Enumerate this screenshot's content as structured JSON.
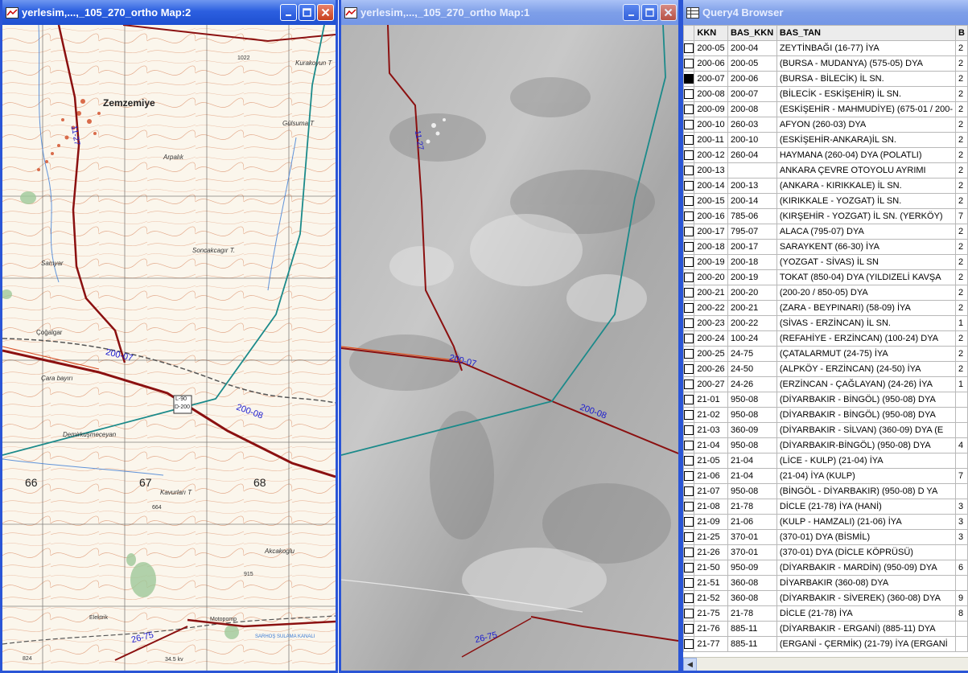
{
  "windows": {
    "map2": {
      "title": "yerlesim,...,_105_270_ortho Map:2"
    },
    "map1": {
      "title": "yerlesim,...,_105_270_ortho Map:1"
    },
    "browser": {
      "title": "Query4 Browser"
    }
  },
  "map2_labels": {
    "town": "Zemzemiye",
    "grid_66": "66",
    "grid_67": "67",
    "grid_68": "68",
    "road_200_07": "200-07",
    "road_200_08": "200-08",
    "road_11_27": "11-27",
    "road_26_75": "26-75",
    "place_kurakoyun": "Kurakoyun T",
    "place_gulsuma": "Gülsuma T",
    "place_arpalik": "Arpalık",
    "place_sancakcagir": "Soncakcagır T.",
    "place_samyar": "Samyar",
    "place_cara": "Çara bayırı",
    "place_demirkan": "Demirkuşmeceyan",
    "place_kavurlari": "Kavurları T",
    "place_akcakogu": "Akcakoglu",
    "place_cogalgar": "Çoğalgar",
    "place_elektrik": "Elektrik",
    "place_motopomp": "Motopomp",
    "place_sarhog": "SARHOŞ SULAMA KANALI",
    "marker_top": "L-90",
    "marker_bottom": "D-200",
    "elev_1022": "1022",
    "elev_664": "664",
    "elev_915": "915",
    "elev_824": "824",
    "kv": "34.5 kv"
  },
  "map1_labels": {
    "road_11_27": "11-27",
    "road_200_07": "200-07",
    "road_200_08": "200-08",
    "road_26_75": "26-75"
  },
  "browser": {
    "columns": [
      "KKN",
      "BAS_KKN",
      "BAS_TAN",
      "B"
    ],
    "rows": [
      {
        "kkn": "200-05",
        "bas": "200-04",
        "tan": "ZEYTİNBAĞI (16-77) İYA",
        "b": "2",
        "checked": false
      },
      {
        "kkn": "200-06",
        "bas": "200-05",
        "tan": "(BURSA - MUDANYA) (575-05) DYA",
        "b": "2",
        "checked": false
      },
      {
        "kkn": "200-07",
        "bas": "200-06",
        "tan": "(BURSA - BİLECİK) İL SN.",
        "b": "2",
        "checked": true
      },
      {
        "kkn": "200-08",
        "bas": "200-07",
        "tan": "(BİLECİK - ESKİŞEHİR) İL SN.",
        "b": "2",
        "checked": false
      },
      {
        "kkn": "200-09",
        "bas": "200-08",
        "tan": "(ESKİŞEHİR - MAHMUDİYE) (675-01 / 200-",
        "b": "2",
        "checked": false
      },
      {
        "kkn": "200-10",
        "bas": "260-03",
        "tan": "AFYON (260-03) DYA",
        "b": "2",
        "checked": false
      },
      {
        "kkn": "200-11",
        "bas": "200-10",
        "tan": "(ESKİŞEHİR-ANKARA)İL SN.",
        "b": "2",
        "checked": false
      },
      {
        "kkn": "200-12",
        "bas": "260-04",
        "tan": "HAYMANA (260-04) DYA (POLATLI)",
        "b": "2",
        "checked": false
      },
      {
        "kkn": "200-13",
        "bas": "",
        "tan": "ANKARA ÇEVRE OTOYOLU AYRIMI",
        "b": "2",
        "checked": false
      },
      {
        "kkn": "200-14",
        "bas": "200-13",
        "tan": "(ANKARA - KIRIKKALE) İL SN.",
        "b": "2",
        "checked": false
      },
      {
        "kkn": "200-15",
        "bas": "200-14",
        "tan": "(KIRIKKALE - YOZGAT) İL SN.",
        "b": "2",
        "checked": false
      },
      {
        "kkn": "200-16",
        "bas": "785-06",
        "tan": "(KIRŞEHİR - YOZGAT) İL SN. (YERKÖY)",
        "b": "7",
        "checked": false
      },
      {
        "kkn": "200-17",
        "bas": "795-07",
        "tan": "ALACA (795-07) DYA",
        "b": "2",
        "checked": false
      },
      {
        "kkn": "200-18",
        "bas": "200-17",
        "tan": "SARAYKENT (66-30) İYA",
        "b": "2",
        "checked": false
      },
      {
        "kkn": "200-19",
        "bas": "200-18",
        "tan": "(YOZGAT - SİVAS) İL SN",
        "b": "2",
        "checked": false
      },
      {
        "kkn": "200-20",
        "bas": "200-19",
        "tan": "TOKAT (850-04) DYA (YILDIZELİ KAVŞA",
        "b": "2",
        "checked": false
      },
      {
        "kkn": "200-21",
        "bas": "200-20",
        "tan": "(200-20 / 850-05) DYA",
        "b": "2",
        "checked": false
      },
      {
        "kkn": "200-22",
        "bas": "200-21",
        "tan": "(ZARA - BEYPINARI) (58-09) İYA",
        "b": "2",
        "checked": false
      },
      {
        "kkn": "200-23",
        "bas": "200-22",
        "tan": "(SİVAS - ERZİNCAN) İL SN.",
        "b": "1",
        "checked": false
      },
      {
        "kkn": "200-24",
        "bas": "100-24",
        "tan": "(REFAHİYE - ERZİNCAN) (100-24) DYA",
        "b": "2",
        "checked": false
      },
      {
        "kkn": "200-25",
        "bas": "24-75",
        "tan": "(ÇATALARMUT (24-75) İYA",
        "b": "2",
        "checked": false
      },
      {
        "kkn": "200-26",
        "bas": "24-50",
        "tan": "(ALPKÖY - ERZİNCAN) (24-50) İYA",
        "b": "2",
        "checked": false
      },
      {
        "kkn": "200-27",
        "bas": "24-26",
        "tan": "(ERZİNCAN - ÇAĞLAYAN) (24-26) İYA",
        "b": "1",
        "checked": false
      },
      {
        "kkn": "21-01",
        "bas": "950-08",
        "tan": "(DİYARBAKIR - BİNGÖL) (950-08) DYA",
        "b": "",
        "checked": false
      },
      {
        "kkn": "21-02",
        "bas": "950-08",
        "tan": "(DİYARBAKIR - BİNGÖL) (950-08) DYA",
        "b": "",
        "checked": false
      },
      {
        "kkn": "21-03",
        "bas": "360-09",
        "tan": "(DİYARBAKIR - SİLVAN) (360-09) DYA (E",
        "b": "",
        "checked": false
      },
      {
        "kkn": "21-04",
        "bas": "950-08",
        "tan": "(DİYARBAKIR-BİNGÖL) (950-08) DYA",
        "b": "4",
        "checked": false
      },
      {
        "kkn": "21-05",
        "bas": "21-04",
        "tan": "(LİCE - KULP) (21-04) İYA",
        "b": "",
        "checked": false
      },
      {
        "kkn": "21-06",
        "bas": "21-04",
        "tan": "(21-04) İYA (KULP)",
        "b": "7",
        "checked": false
      },
      {
        "kkn": "21-07",
        "bas": "950-08",
        "tan": "(BİNGÖL - DİYARBAKIR) (950-08) D YA",
        "b": "",
        "checked": false
      },
      {
        "kkn": "21-08",
        "bas": "21-78",
        "tan": "DİCLE (21-78) İYA (HANİ)",
        "b": "3",
        "checked": false
      },
      {
        "kkn": "21-09",
        "bas": "21-06",
        "tan": "(KULP - HAMZALI) (21-06) İYA",
        "b": "3",
        "checked": false
      },
      {
        "kkn": "21-25",
        "bas": "370-01",
        "tan": "(370-01) DYA (BİSMİL)",
        "b": "3",
        "checked": false
      },
      {
        "kkn": "21-26",
        "bas": "370-01",
        "tan": "(370-01) DYA (DİCLE KÖPRÜSÜ)",
        "b": "",
        "checked": false
      },
      {
        "kkn": "21-50",
        "bas": "950-09",
        "tan": "(DİYARBAKIR - MARDİN) (950-09) DYA",
        "b": "6",
        "checked": false
      },
      {
        "kkn": "21-51",
        "bas": "360-08",
        "tan": "DİYARBAKIR (360-08) DYA",
        "b": "",
        "checked": false
      },
      {
        "kkn": "21-52",
        "bas": "360-08",
        "tan": "(DİYARBAKIR - SİVEREK) (360-08) DYA",
        "b": "9",
        "checked": false
      },
      {
        "kkn": "21-75",
        "bas": "21-78",
        "tan": "DİCLE (21-78) İYA",
        "b": "8",
        "checked": false
      },
      {
        "kkn": "21-76",
        "bas": "885-11",
        "tan": "(DİYARBAKIR - ERGANİ) (885-11) DYA",
        "b": "",
        "checked": false
      },
      {
        "kkn": "21-77",
        "bas": "885-11",
        "tan": "(ERGANİ - ÇERMİK) (21-79) İYA (ERGANİ",
        "b": "",
        "checked": false
      }
    ]
  }
}
